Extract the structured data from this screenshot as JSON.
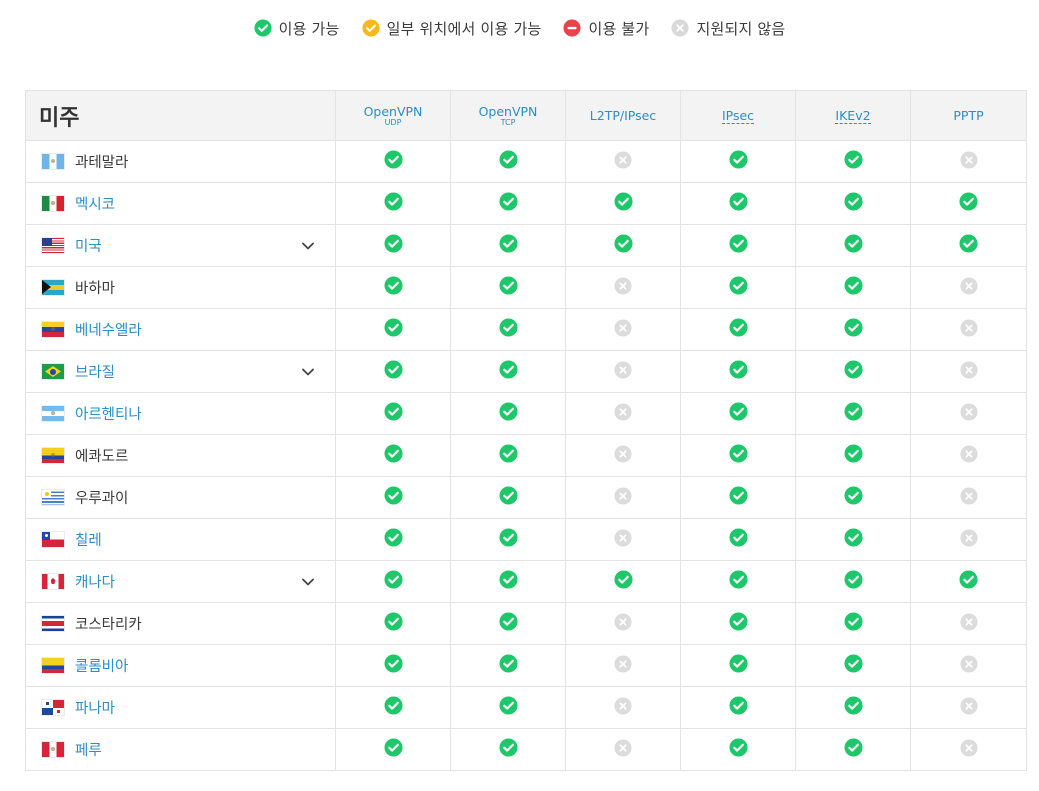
{
  "legend": [
    {
      "status": "available",
      "label": "이용 가능",
      "icon": "check-circle-icon",
      "color": "#1ec76a"
    },
    {
      "status": "partial",
      "label": "일부 위치에서 이용 가능",
      "icon": "check-circle-icon",
      "color": "#f6b91b"
    },
    {
      "status": "unavailable",
      "label": "이용 불가",
      "icon": "minus-circle-icon",
      "color": "#e8424a"
    },
    {
      "status": "unsupported",
      "label": "지원되지 않음",
      "icon": "x-circle-icon",
      "color": "#d9d9d9"
    }
  ],
  "table": {
    "region": "미주",
    "protocols": [
      {
        "name": "OpenVPN",
        "sub": "UDP",
        "link": false
      },
      {
        "name": "OpenVPN",
        "sub": "TCP",
        "link": false
      },
      {
        "name": "L2TP/IPsec",
        "sub": "",
        "link": false
      },
      {
        "name": "IPsec",
        "sub": "",
        "link": true
      },
      {
        "name": "IKEv2",
        "sub": "",
        "link": true
      },
      {
        "name": "PPTP",
        "sub": "",
        "link": false
      }
    ],
    "rows": [
      {
        "name": "과테말라",
        "link": false,
        "expandable": false,
        "flag": "guatemala",
        "status": [
          "y",
          "y",
          "n",
          "y",
          "y",
          "n"
        ]
      },
      {
        "name": "멕시코",
        "link": true,
        "expandable": false,
        "flag": "mexico",
        "status": [
          "y",
          "y",
          "y",
          "y",
          "y",
          "y"
        ]
      },
      {
        "name": "미국",
        "link": true,
        "expandable": true,
        "flag": "usa",
        "status": [
          "y",
          "y",
          "y",
          "y",
          "y",
          "y"
        ]
      },
      {
        "name": "바하마",
        "link": false,
        "expandable": false,
        "flag": "bahamas",
        "status": [
          "y",
          "y",
          "n",
          "y",
          "y",
          "n"
        ]
      },
      {
        "name": "베네수엘라",
        "link": true,
        "expandable": false,
        "flag": "venezuela",
        "status": [
          "y",
          "y",
          "n",
          "y",
          "y",
          "n"
        ]
      },
      {
        "name": "브라질",
        "link": true,
        "expandable": true,
        "flag": "brazil",
        "status": [
          "y",
          "y",
          "n",
          "y",
          "y",
          "n"
        ]
      },
      {
        "name": "아르헨티나",
        "link": true,
        "expandable": false,
        "flag": "argentina",
        "status": [
          "y",
          "y",
          "n",
          "y",
          "y",
          "n"
        ]
      },
      {
        "name": "에콰도르",
        "link": false,
        "expandable": false,
        "flag": "ecuador",
        "status": [
          "y",
          "y",
          "n",
          "y",
          "y",
          "n"
        ]
      },
      {
        "name": "우루과이",
        "link": false,
        "expandable": false,
        "flag": "uruguay",
        "status": [
          "y",
          "y",
          "n",
          "y",
          "y",
          "n"
        ]
      },
      {
        "name": "칠레",
        "link": true,
        "expandable": false,
        "flag": "chile",
        "status": [
          "y",
          "y",
          "n",
          "y",
          "y",
          "n"
        ]
      },
      {
        "name": "캐나다",
        "link": true,
        "expandable": true,
        "flag": "canada",
        "status": [
          "y",
          "y",
          "y",
          "y",
          "y",
          "y"
        ]
      },
      {
        "name": "코스타리카",
        "link": false,
        "expandable": false,
        "flag": "costa-rica",
        "status": [
          "y",
          "y",
          "n",
          "y",
          "y",
          "n"
        ]
      },
      {
        "name": "콜롬비아",
        "link": true,
        "expandable": false,
        "flag": "colombia",
        "status": [
          "y",
          "y",
          "n",
          "y",
          "y",
          "n"
        ]
      },
      {
        "name": "파나마",
        "link": true,
        "expandable": false,
        "flag": "panama",
        "status": [
          "y",
          "y",
          "n",
          "y",
          "y",
          "n"
        ]
      },
      {
        "name": "페루",
        "link": true,
        "expandable": false,
        "flag": "peru",
        "status": [
          "y",
          "y",
          "n",
          "y",
          "y",
          "n"
        ]
      }
    ]
  },
  "colors": {
    "link": "#2a8ec7",
    "check": "#1ec76a",
    "unsupported": "#dcdcdc",
    "header_bg": "#f3f3f3",
    "border": "#e3e3e3"
  }
}
